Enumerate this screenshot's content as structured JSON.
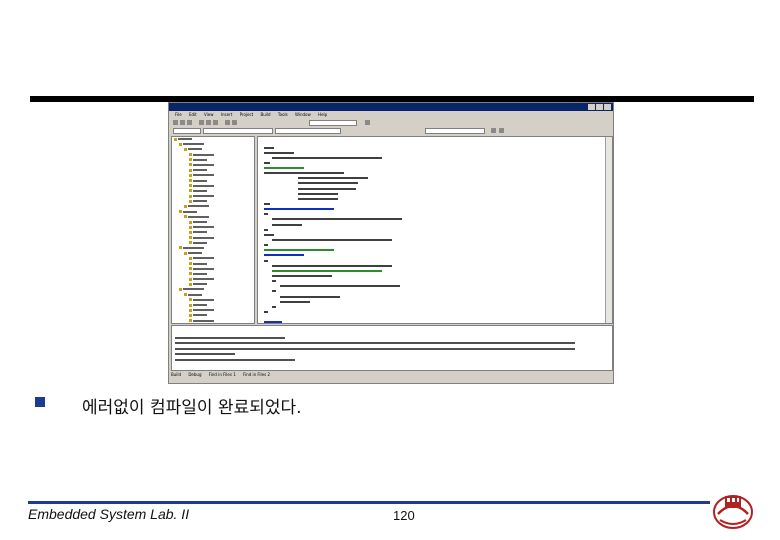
{
  "slide": {
    "bullet_text": "에러없이 컴파일이 완료되었다.",
    "footer_left": "Embedded System Lab. II",
    "page_number": "120"
  },
  "ide": {
    "menu": [
      "File",
      "Edit",
      "View",
      "Insert",
      "Project",
      "Build",
      "Tools",
      "Window",
      "Help"
    ],
    "output_tabs": [
      "Build",
      "Debug",
      "Find in Files 1",
      "Find in Files 2"
    ],
    "colors": {
      "titlebar": "#0a246a",
      "comment": "#2e8b2e",
      "keyword": "#1030c0",
      "code": "#404040"
    }
  },
  "logo": {
    "icon": "university-seal-logo",
    "color": "#b22222"
  }
}
